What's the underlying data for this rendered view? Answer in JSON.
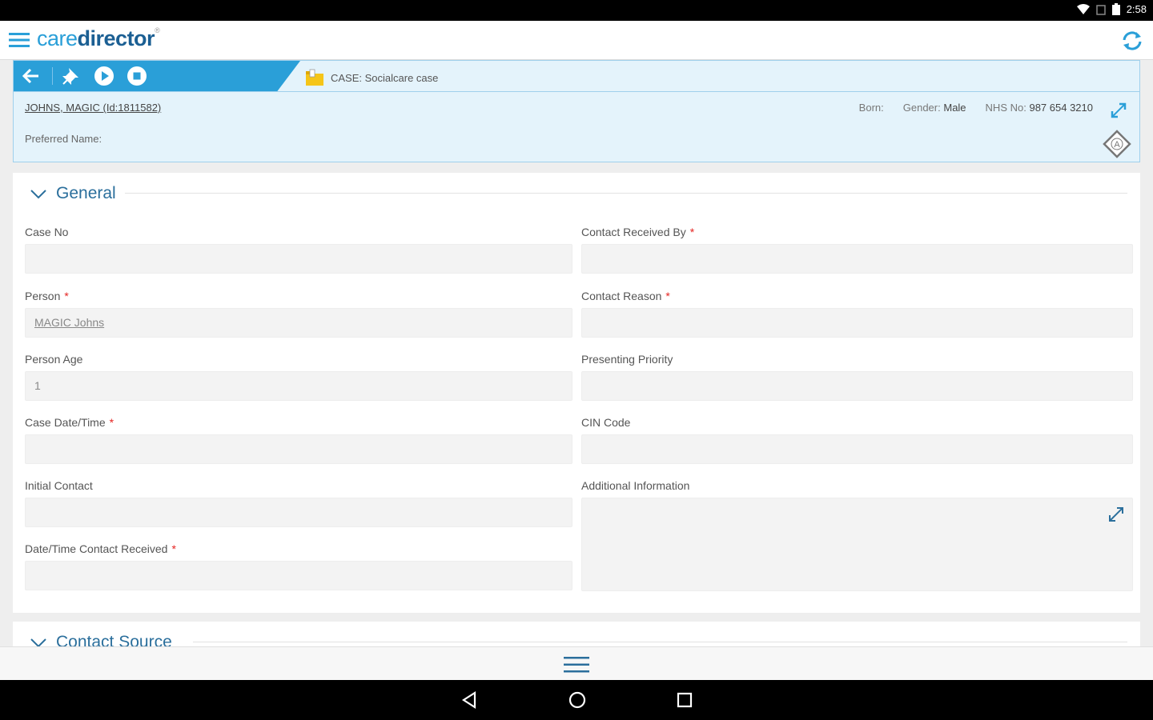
{
  "status_bar": {
    "time": "2:58"
  },
  "app": {
    "logo_care": "care",
    "logo_director": "director",
    "logo_reg": "®"
  },
  "case": {
    "title": "CASE: Socialcare case",
    "person_link": "JOHNS, MAGIC (Id:1811582)",
    "preferred_name_label": "Preferred Name:",
    "born_label": "Born:",
    "gender_label": "Gender:",
    "gender_value": "Male",
    "nhs_label": "NHS No:",
    "nhs_value": "987 654 3210",
    "badge_letter": "A"
  },
  "sections": {
    "general": {
      "title": "General"
    },
    "contact_source": {
      "title": "Contact Source"
    }
  },
  "fields": {
    "case_no": {
      "label": "Case No",
      "value": ""
    },
    "contact_received_by": {
      "label": "Contact Received By",
      "required": "*",
      "value": ""
    },
    "person": {
      "label": "Person",
      "required": "*",
      "value": "MAGIC Johns"
    },
    "contact_reason": {
      "label": "Contact Reason",
      "required": "*",
      "value": ""
    },
    "person_age": {
      "label": "Person Age",
      "value": "1"
    },
    "presenting_priority": {
      "label": "Presenting Priority",
      "value": ""
    },
    "case_datetime": {
      "label": "Case Date/Time",
      "required": "*",
      "value": ""
    },
    "cin_code": {
      "label": "CIN Code",
      "value": ""
    },
    "initial_contact": {
      "label": "Initial Contact",
      "value": ""
    },
    "additional_information": {
      "label": "Additional Information",
      "value": ""
    },
    "datetime_contact_received": {
      "label": "Date/Time Contact Received",
      "required": "*",
      "value": ""
    }
  },
  "icons": {
    "menu": "menu-icon",
    "refresh": "refresh-icon",
    "back": "back-arrow-icon",
    "pin": "pin-icon",
    "play": "play-icon",
    "stop": "stop-icon",
    "case_folder": "case-folder-icon",
    "expand": "expand-icon",
    "chevron": "chevron-down-icon"
  },
  "colors": {
    "brand_blue": "#2a9fd8",
    "brand_dark": "#1b5f93",
    "header_bg": "#e4f3fb",
    "section_title": "#2b6f9c",
    "required": "#e52421"
  }
}
